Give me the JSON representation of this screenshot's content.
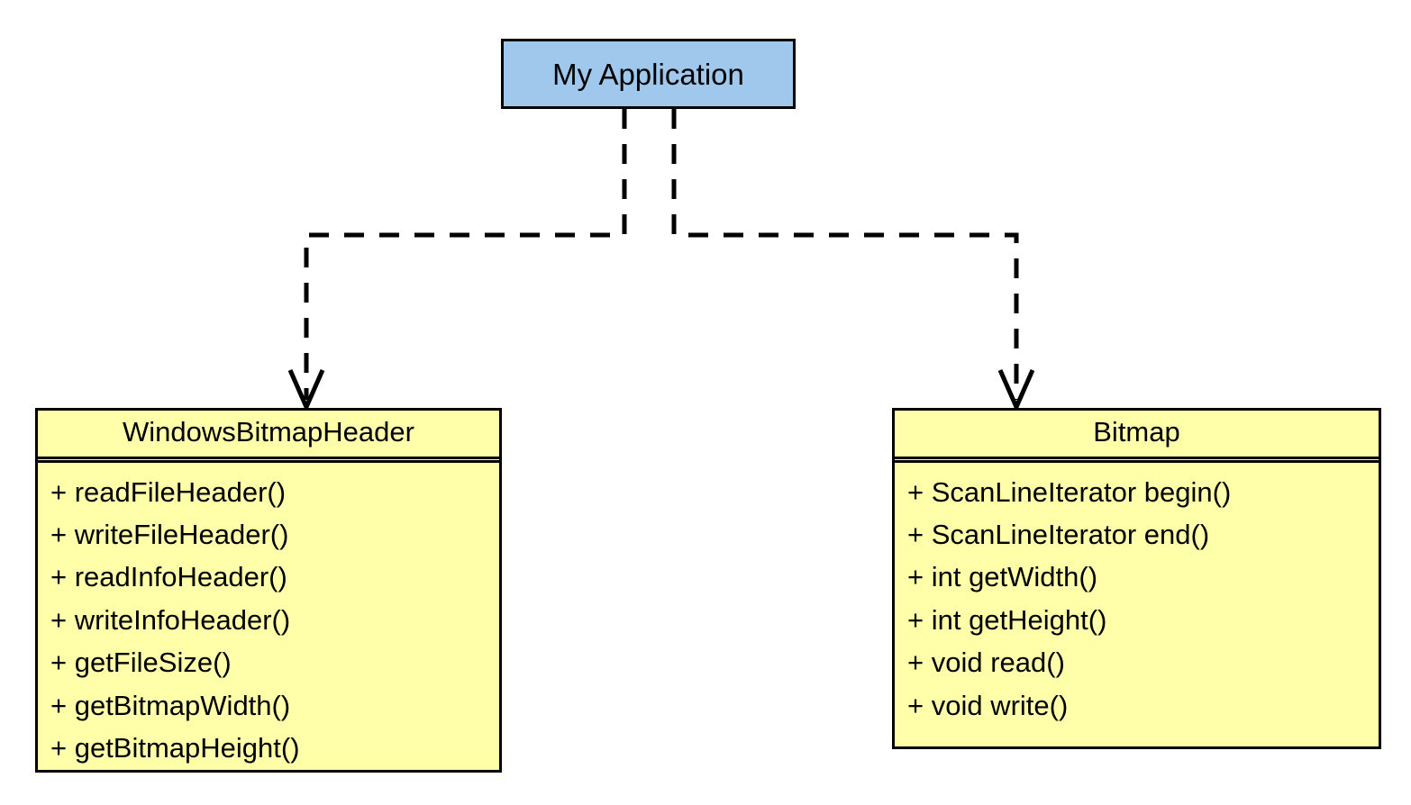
{
  "diagram": {
    "type": "uml-class-diagram",
    "background_color": "#ffffff",
    "border_color": "#000000"
  },
  "actor": {
    "title": "My Application",
    "fill_color": "#a0c8ec"
  },
  "classes": [
    {
      "name": "WindowsBitmapHeader",
      "fill_color": "#ffffaa",
      "members": [
        "+ readFileHeader()",
        "+ writeFileHeader()",
        "+ readInfoHeader()",
        "+ writeInfoHeader()",
        "+ getFileSize()",
        "+ getBitmapWidth()",
        "+ getBitmapHeight()"
      ]
    },
    {
      "name": "Bitmap",
      "fill_color": "#ffffaa",
      "members": [
        "+ ScanLineIterator begin()",
        "+ ScanLineIterator end()",
        "+ int getWidth()",
        "+ int getHeight()",
        "+ void read()",
        "+ void write()"
      ]
    }
  ],
  "connectors": [
    {
      "name": "dependency-to-windowsbitmapheader",
      "from": "My Application",
      "to": "WindowsBitmapHeader",
      "style": "dashed",
      "arrowhead": "open"
    },
    {
      "name": "dependency-to-bitmap",
      "from": "My Application",
      "to": "Bitmap",
      "style": "dashed",
      "arrowhead": "open"
    }
  ]
}
